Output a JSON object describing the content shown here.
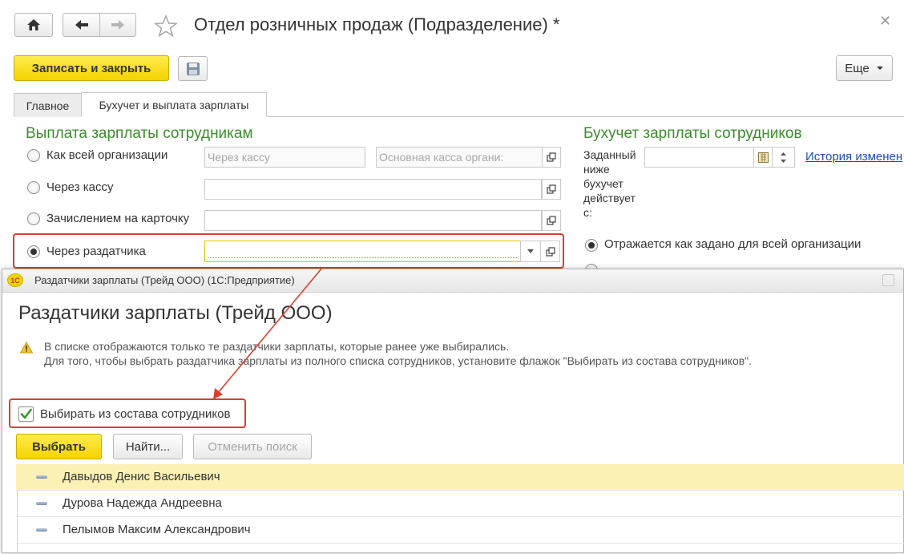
{
  "window": {
    "title": "Отдел розничных продаж (Подразделение) *",
    "home_icon": "home-icon",
    "back_icon": "arrow-left-icon",
    "forward_icon": "arrow-right-icon",
    "favorite_icon": "star-icon",
    "close_icon": "close-icon"
  },
  "toolbar": {
    "save_close_label": "Записать и закрыть",
    "save_icon": "floppy-disk-icon",
    "more_label": "Еще"
  },
  "tabs": [
    {
      "label": "Главное"
    },
    {
      "label": "Бухучет и выплата зарплаты"
    }
  ],
  "payout": {
    "heading": "Выплата зарплаты сотрудникам",
    "options": [
      {
        "label": "Как всей организации",
        "field1_placeholder": "Через кассу",
        "field2_placeholder": "Основная касса органи:"
      },
      {
        "label": "Через кассу"
      },
      {
        "label": "Зачислением на карточку"
      },
      {
        "label": "Через раздатчика",
        "selected": true
      }
    ]
  },
  "accounting": {
    "heading": "Бухучет зарплаты сотрудников",
    "date_label": [
      "Заданный",
      "ниже",
      "бухучет",
      "действует",
      "с:"
    ],
    "history_link": "История изменен",
    "option_label": "Отражается как задано для всей организации"
  },
  "dialog": {
    "window_title": "Раздатчики зарплаты (Трейд ООО) (1С:Предприятие)",
    "logo_text": "1С",
    "heading": "Раздатчики зарплаты (Трейд ООО)",
    "warning_line1": "В списке отображаются только те раздатчики зарплаты, которые ранее уже выбирались.",
    "warning_line2": "Для того, чтобы выбрать раздатчика зарплаты из полного списка сотрудников, установите флажок \"Выбирать из состава сотрудников\".",
    "checkbox_label": "Выбирать из состава сотрудников",
    "checkbox_checked": true,
    "select_label": "Выбрать",
    "find_label": "Найти...",
    "cancel_search_label": "Отменить поиск",
    "employees": [
      {
        "name": "Давыдов Денис Васильевич",
        "selected": true
      },
      {
        "name": "Дурова Надежда Андреевна"
      },
      {
        "name": "Пелымов Максим Александрович"
      }
    ]
  },
  "colors": {
    "accent_yellow": "#f5d300",
    "heading_green": "#3c8c2e",
    "highlight_red": "#d6412d",
    "link_blue": "#1d4fa8",
    "selected_row": "#fbf1b4"
  }
}
